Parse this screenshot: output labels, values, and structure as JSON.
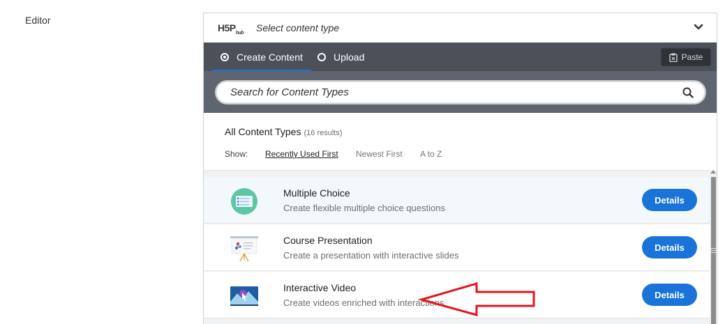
{
  "page": {
    "editor_label": "Editor"
  },
  "hub": {
    "logo": "H5P",
    "logo_sub": "hub",
    "title": "Select content type",
    "tabs": [
      {
        "label": "Create Content",
        "selected": true
      },
      {
        "label": "Upload",
        "selected": false
      }
    ],
    "paste_label": "Paste",
    "search_placeholder": "Search for Content Types"
  },
  "filters": {
    "title": "All Content Types",
    "count": "(16 results)",
    "show_label": "Show:",
    "sort_options": [
      {
        "label": "Recently Used First",
        "active": true
      },
      {
        "label": "Newest First",
        "active": false
      },
      {
        "label": "A to Z",
        "active": false
      }
    ]
  },
  "content_types": [
    {
      "title": "Multiple Choice",
      "description": "Create flexible multiple choice questions",
      "button": "Details",
      "icon": "multiple-choice-icon"
    },
    {
      "title": "Course Presentation",
      "description": "Create a presentation with interactive slides",
      "button": "Details",
      "icon": "course-presentation-icon"
    },
    {
      "title": "Interactive Video",
      "description": "Create videos enriched with interactions",
      "button": "Details",
      "icon": "interactive-video-icon"
    }
  ],
  "colors": {
    "accent": "#1a73d9",
    "tabbar": "#4b5059",
    "searchbar": "#5e6570",
    "annotation": "#e0161f"
  }
}
